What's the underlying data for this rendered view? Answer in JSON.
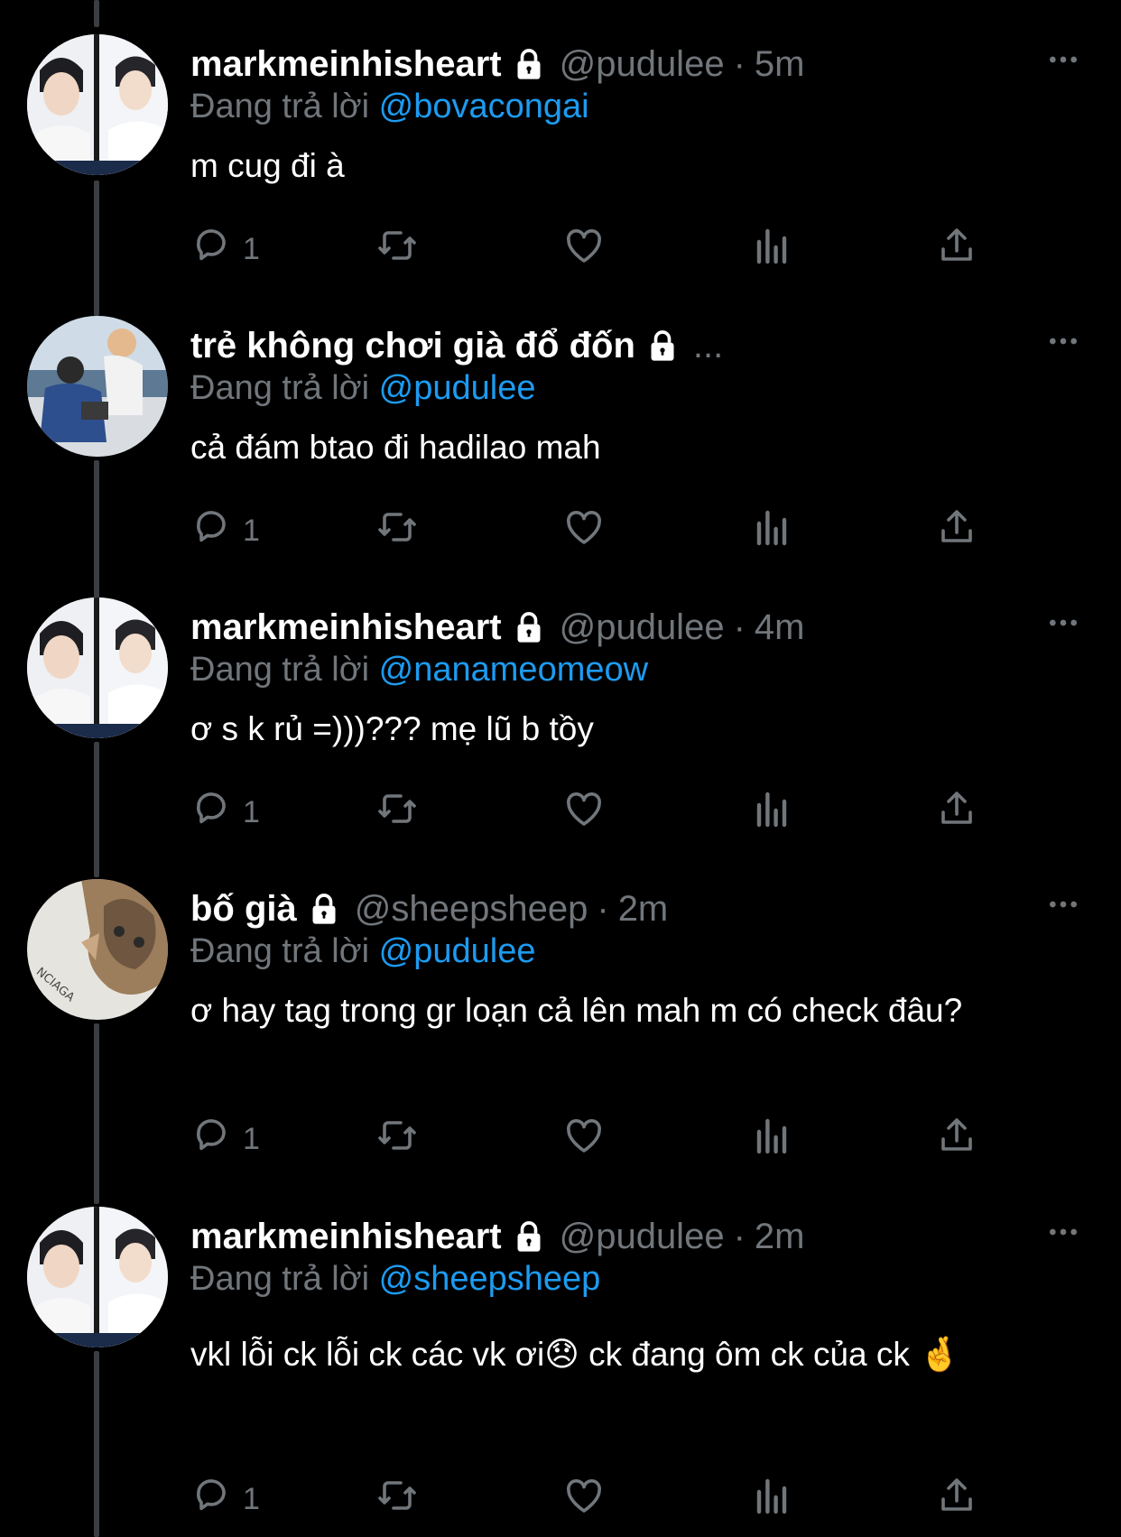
{
  "tweets": [
    {
      "name": "markmeinhisheart",
      "handle": "@pudulee",
      "time": "5m",
      "reply_prefix": "Đang trả lời",
      "reply_to": "@bovacongai",
      "text": "m cug đi à",
      "reply_count": "1",
      "avatar": "avatar-photo-two-panel"
    },
    {
      "name": "trẻ không chơi già đổ đốn",
      "handle": "",
      "time": "",
      "truncated": "...",
      "reply_prefix": "Đang trả lời",
      "reply_to": "@pudulee",
      "text": "cả đám btao đi hadilao mah",
      "reply_count": "1",
      "avatar": "avatar-photo-two-people"
    },
    {
      "name": "markmeinhisheart",
      "handle": "@pudulee",
      "time": "4m",
      "reply_prefix": "Đang trả lời",
      "reply_to": "@nanameomeow",
      "text": "ơ s k rủ =)))??? mẹ lũ b tồy",
      "reply_count": "1",
      "avatar": "avatar-photo-two-panel"
    },
    {
      "name": "bố già",
      "handle": "@sheepsheep",
      "time": "2m",
      "reply_prefix": "Đang trả lời",
      "reply_to": "@pudulee",
      "text": "ơ hay tag trong gr loạn cả lên mah m có check đâu?",
      "reply_count": "1",
      "avatar": "avatar-photo-cat"
    },
    {
      "name": "markmeinhisheart",
      "handle": "@pudulee",
      "time": "2m",
      "reply_prefix": "Đang trả lời",
      "reply_to": "@sheepsheep",
      "text": "vkl lỗi ck lỗi ck các vk ơi😞 ck đang ôm ck của ck 🤞",
      "reply_count": "1",
      "avatar": "avatar-photo-two-panel"
    }
  ],
  "icons": {
    "lock": "lock-icon",
    "more": "more-icon",
    "reply": "reply-icon",
    "retweet": "retweet-icon",
    "like": "like-icon",
    "views": "views-icon",
    "share": "share-icon"
  },
  "colors": {
    "background": "#000000",
    "text": "#ffffff",
    "muted": "#71767b",
    "mention": "#1d9bf0",
    "thread_line": "#3a3d41"
  }
}
